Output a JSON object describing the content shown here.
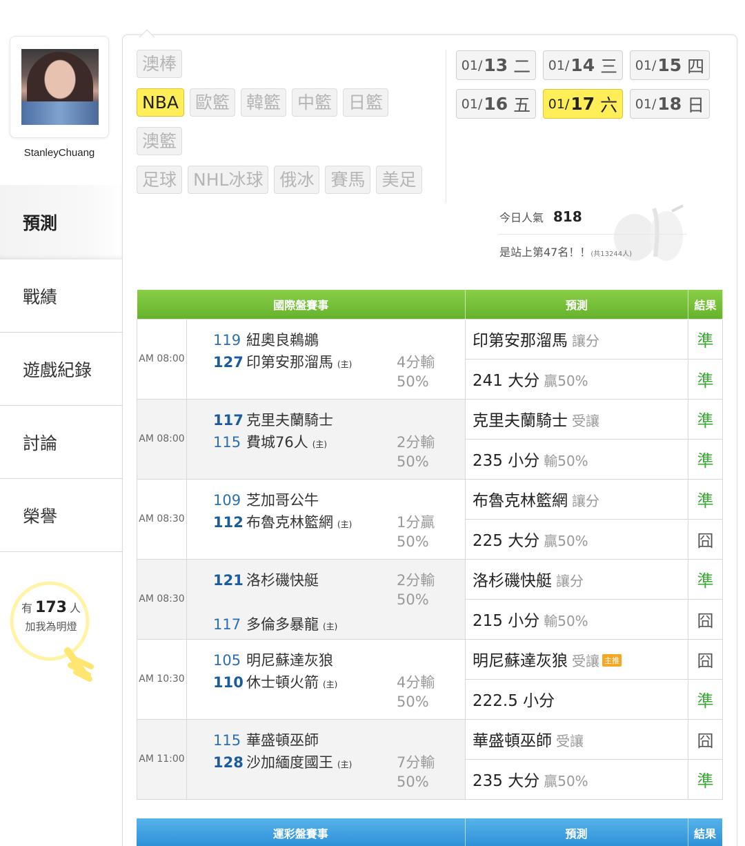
{
  "user": {
    "name": "StanleyChuang"
  },
  "nav": [
    {
      "label": "預測",
      "active": true
    },
    {
      "label": "戰績",
      "active": false
    },
    {
      "label": "遊戲紀錄",
      "active": false
    },
    {
      "label": "討論",
      "active": false
    },
    {
      "label": "榮譽",
      "active": false
    }
  ],
  "fans": {
    "prefix": "有",
    "count": "173",
    "suffix": "人",
    "label": "加我為明燈"
  },
  "sports": {
    "row1": [
      "澳棒"
    ],
    "row2": [
      "NBA",
      "歐籃",
      "韓籃",
      "中籃",
      "日籃"
    ],
    "row3": [
      "澳籃"
    ],
    "row4": [
      "足球",
      "NHL冰球",
      "俄冰",
      "賽馬",
      "美足"
    ],
    "active": "NBA"
  },
  "dates": [
    {
      "md": "01/",
      "day": "13",
      "dow": "二",
      "active": false
    },
    {
      "md": "01/",
      "day": "14",
      "dow": "三",
      "active": false
    },
    {
      "md": "01/",
      "day": "15",
      "dow": "四",
      "active": false
    },
    {
      "md": "01/",
      "day": "16",
      "dow": "五",
      "active": false
    },
    {
      "md": "01/",
      "day": "17",
      "dow": "六",
      "active": true
    },
    {
      "md": "01/",
      "day": "18",
      "dow": "日",
      "active": false
    }
  ],
  "popularity": {
    "label": "今日人氣",
    "value": "818",
    "rank_text": "是站上第47名！！",
    "rank_total": "(共13244人)"
  },
  "intl_table": {
    "headers": [
      "國際盤賽事",
      "預測",
      "結果"
    ],
    "games": [
      {
        "time": "AM 08:00",
        "away_score": "119",
        "away": "紐奧良鵜鶘",
        "home_score": "127",
        "home": "印第安那溜馬",
        "host_mark": "(主)",
        "spread_result": "4分輸",
        "pct": "50%",
        "winner": "home",
        "pick1": "印第安那溜馬",
        "pick1_sub": "讓分",
        "res1": "準",
        "pick2": "241 大分",
        "pick2_sub": "贏50%",
        "res2": "準"
      },
      {
        "time": "AM 08:00",
        "away_score": "117",
        "away": "克里夫蘭騎士",
        "home_score": "115",
        "home": "費城76人",
        "host_mark": "(主)",
        "spread_result": "2分輸",
        "pct": "50%",
        "winner": "away",
        "pick1": "克里夫蘭騎士",
        "pick1_sub": "受讓",
        "res1": "準",
        "pick2": "235 小分",
        "pick2_sub": "輸50%",
        "res2": "準"
      },
      {
        "time": "AM 08:30",
        "away_score": "109",
        "away": "芝加哥公牛",
        "home_score": "112",
        "home": "布魯克林籃網",
        "host_mark": "(主)",
        "spread_result": "1分贏",
        "pct": "50%",
        "winner": "home",
        "pick1": "布魯克林籃網",
        "pick1_sub": "讓分",
        "res1": "準",
        "pick2": "225 大分",
        "pick2_sub": "贏50%",
        "res2": "囧"
      },
      {
        "time": "AM 08:30",
        "away_score": "121",
        "away": "洛杉磯快艇",
        "home_score": "117",
        "home": "多倫多暴龍",
        "host_mark": "(主)",
        "spread_result": "2分輸",
        "pct": "50%",
        "winner": "away",
        "pick1": "洛杉磯快艇",
        "pick1_sub": "讓分",
        "res1": "準",
        "pick2": "215 小分",
        "pick2_sub": "輸50%",
        "res2": "囧"
      },
      {
        "time": "AM 10:30",
        "away_score": "105",
        "away": "明尼蘇達灰狼",
        "home_score": "110",
        "home": "休士頓火箭",
        "host_mark": "(主)",
        "spread_result": "4分輸",
        "pct": "50%",
        "winner": "home",
        "pick1": "明尼蘇達灰狼",
        "pick1_sub": "受讓",
        "pick1_tag": "主推",
        "res1": "囧",
        "pick2": "222.5 小分",
        "pick2_sub": "",
        "res2": "準"
      },
      {
        "time": "AM 11:00",
        "away_score": "115",
        "away": "華盛頓巫師",
        "home_score": "128",
        "home": "沙加緬度國王",
        "host_mark": "(主)",
        "spread_result": "7分輸",
        "pct": "50%",
        "winner": "home",
        "pick1": "華盛頓巫師",
        "pick1_sub": "受讓",
        "res1": "囧",
        "pick2": "235 大分",
        "pick2_sub": "贏50%",
        "res2": "準"
      }
    ]
  },
  "lottery_table": {
    "headers": [
      "運彩盤賽事",
      "預測",
      "結果"
    ]
  },
  "colors": {
    "accent_yellow": "#ffee58",
    "green_header": "#66b22c",
    "blue_header": "#2d8fd6",
    "correct": "#3aaa35"
  }
}
